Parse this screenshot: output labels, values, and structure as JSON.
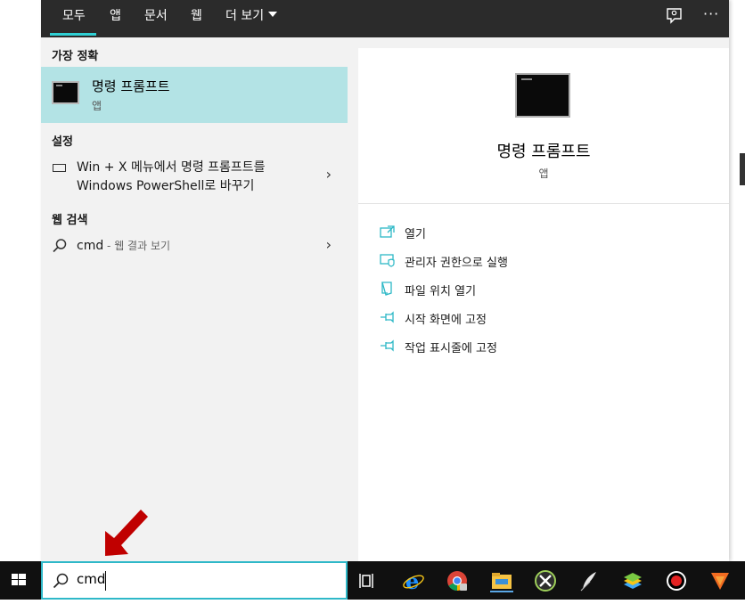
{
  "tabs": [
    {
      "label": "모두",
      "active": true
    },
    {
      "label": "앱"
    },
    {
      "label": "문서"
    },
    {
      "label": "웹"
    },
    {
      "label": "더 보기"
    }
  ],
  "header_icons": {
    "feedback": "feedback-icon",
    "more": "···"
  },
  "results": {
    "best_match_label": "가장 정확",
    "best_match": {
      "title": "명령 프롬프트",
      "subtitle": "앱",
      "icon": "terminal-icon"
    },
    "settings_label": "설정",
    "settings_item": {
      "line1": "Win + X 메뉴에서 명령 프롬프트를",
      "line2": "Windows PowerShell로 바꾸기",
      "icon": "keyboard-icon"
    },
    "web_label": "웹 검색",
    "web_item": {
      "query": "cmd",
      "suffix": " - 웹 결과 보기",
      "icon": "search-icon"
    },
    "chevron": "›"
  },
  "detail": {
    "title": "명령 프롬프트",
    "subtitle": "앱",
    "actions": [
      {
        "label": "열기",
        "icon": "open-icon"
      },
      {
        "label": "관리자 권한으로 실행",
        "icon": "run-as-admin-icon"
      },
      {
        "label": "파일 위치 열기",
        "icon": "file-location-icon"
      },
      {
        "label": "시작 화면에 고정",
        "icon": "pin-icon"
      },
      {
        "label": "작업 표시줄에 고정",
        "icon": "pin-icon"
      }
    ]
  },
  "taskbar": {
    "search_value": "cmd",
    "apps": [
      "task-view-icon",
      "internet-explorer-icon",
      "chrome-icon",
      "file-explorer-icon",
      "xbox-icon",
      "app-icon",
      "bluestacks-icon",
      "record-icon",
      "vlc-icon"
    ]
  },
  "colors": {
    "accent": "#2fd0d4",
    "selected": "#b3e3e5",
    "taskbar": "#101010",
    "annotation": "#c00000"
  }
}
